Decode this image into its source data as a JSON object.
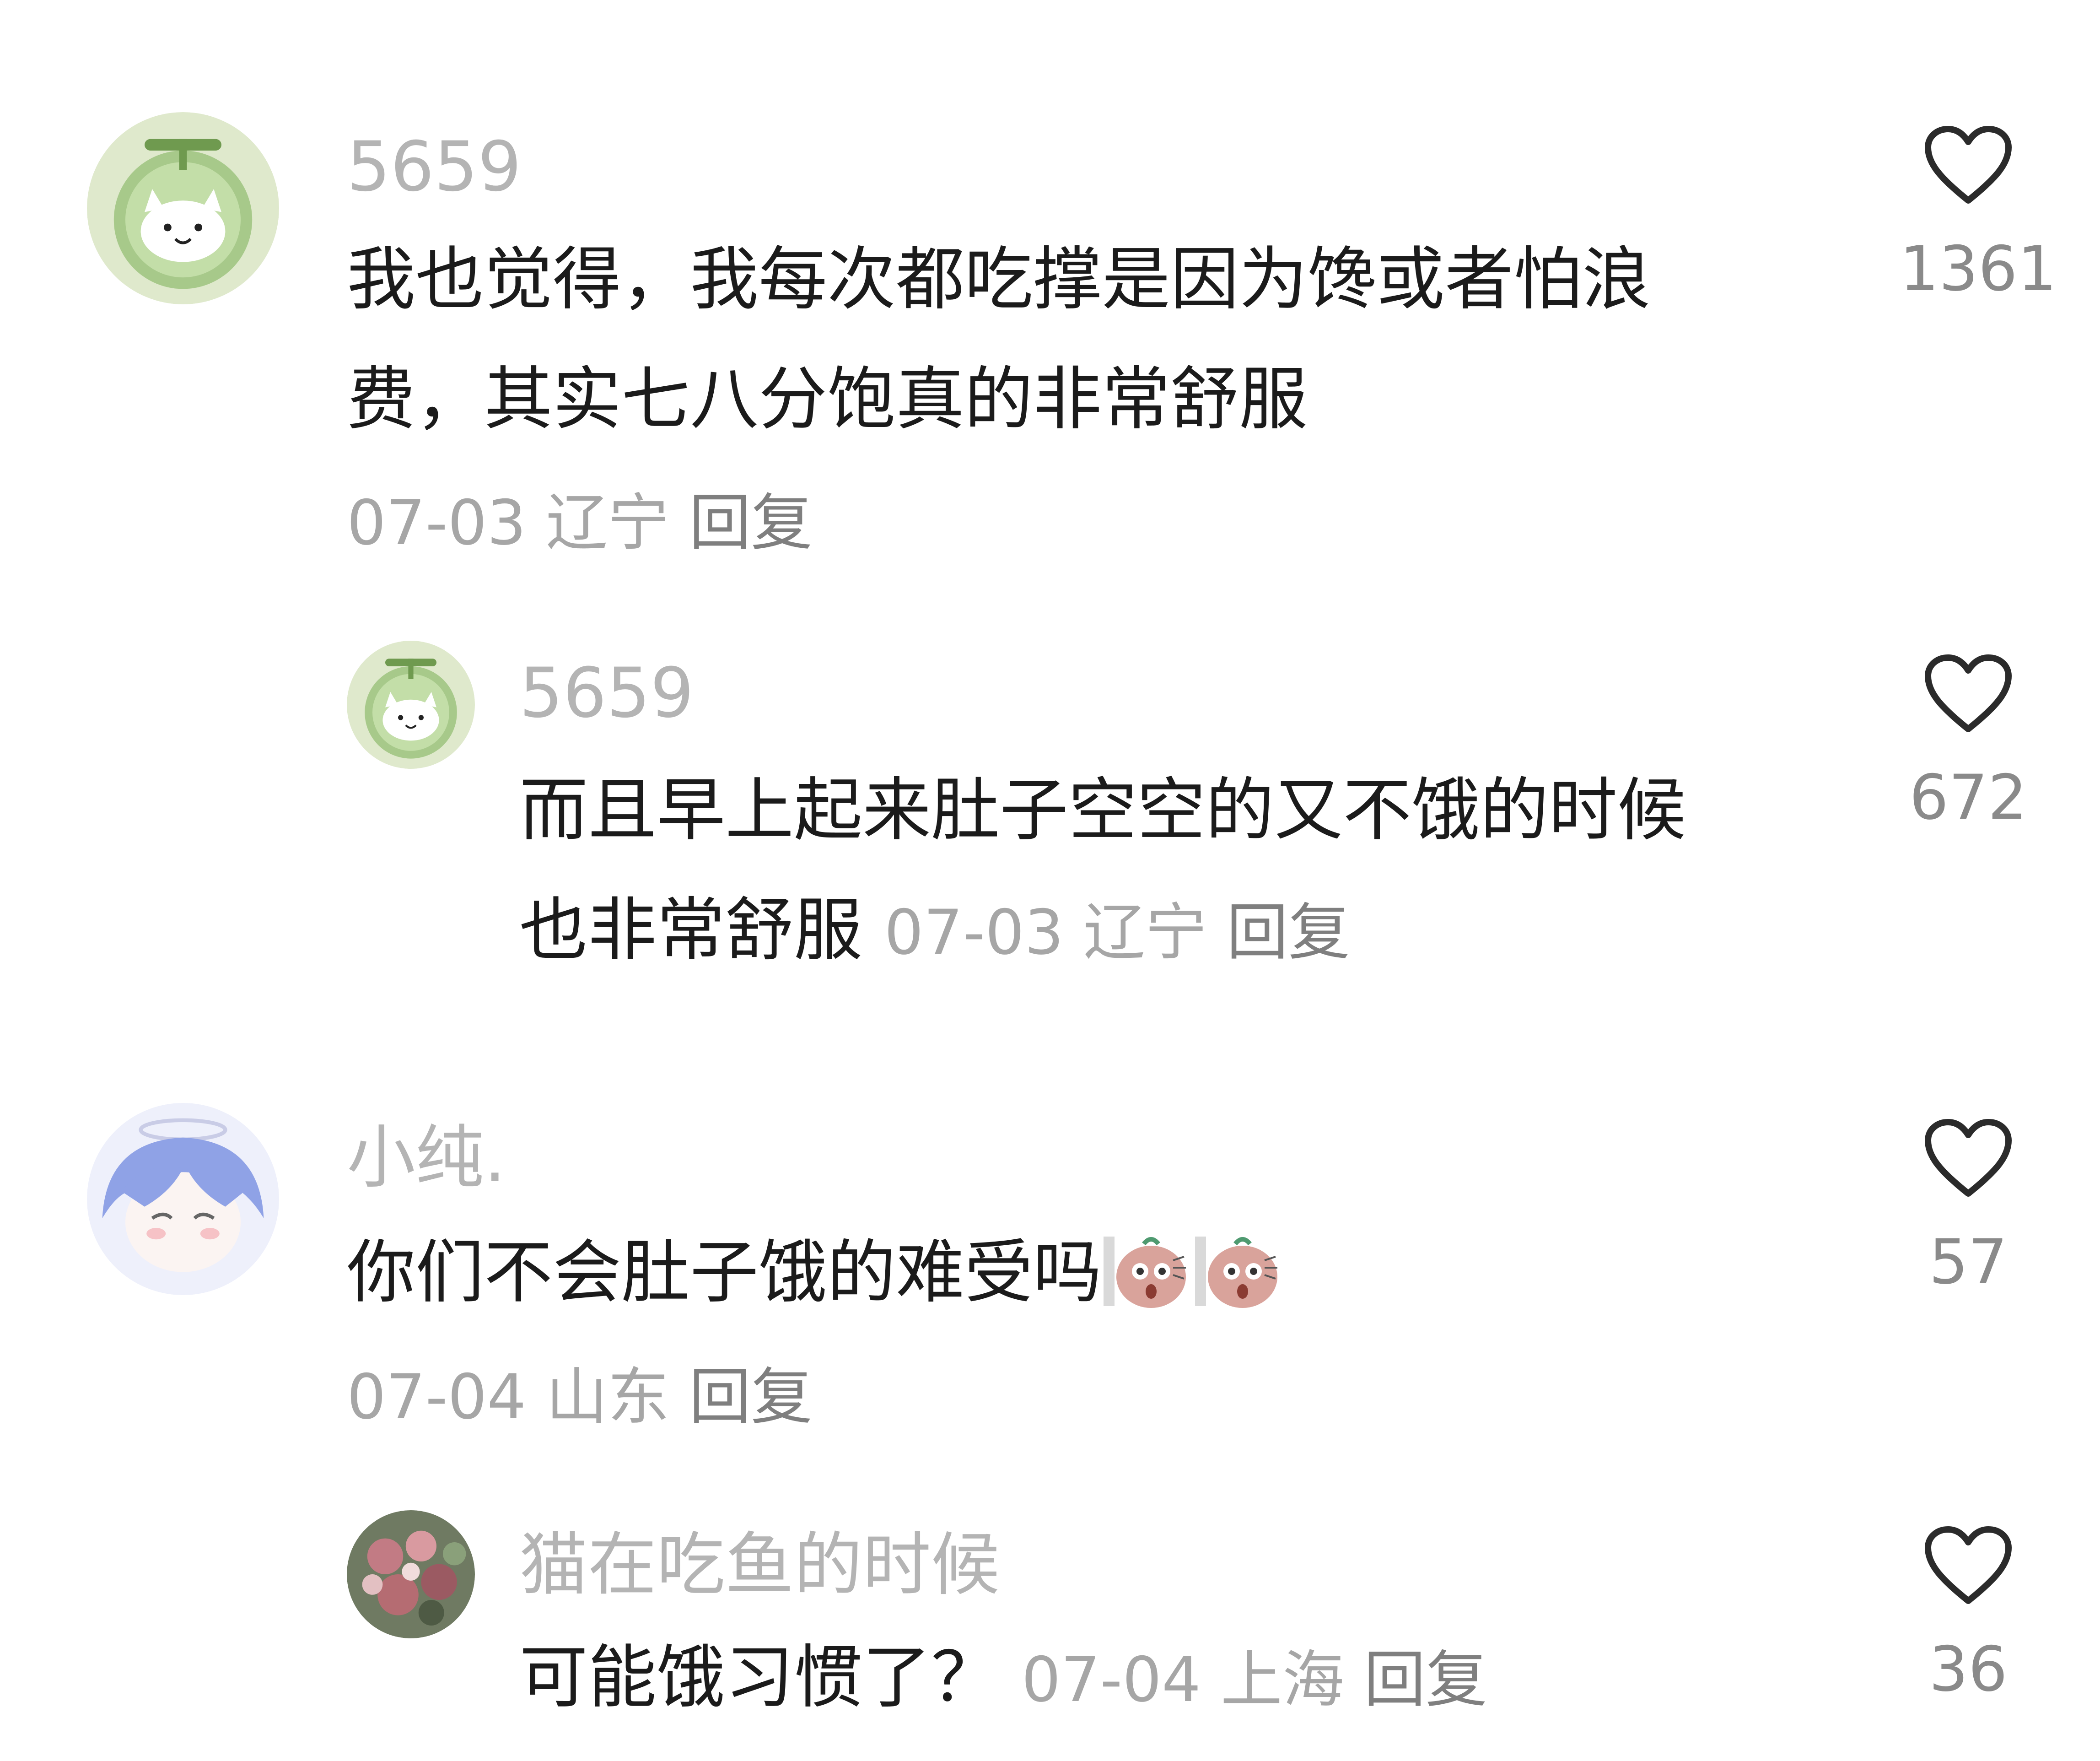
{
  "comments": [
    {
      "username": "5659",
      "text_line1": "我也觉得，我每次都吃撑是因为馋或者怕浪",
      "text_line2": "费，其实七八分饱真的非常舒服",
      "date": "07-03",
      "location": "辽宁",
      "reply_label": "回复",
      "likes": "1361",
      "avatar_icon": "melon-cat-avatar"
    },
    {
      "username": "5659",
      "text_line1": "而且早上起来肚子空空的又不饿的时候",
      "text_line2": "也非常舒服",
      "date": "07-03",
      "location": "辽宁",
      "reply_label": "回复",
      "likes": "672",
      "avatar_icon": "melon-cat-avatar",
      "is_reply": true
    },
    {
      "username": "小纯.",
      "text_line1": "你们不会肚子饿的难受吗",
      "stickers": [
        "shocked-sticker",
        "shocked-sticker"
      ],
      "date": "07-04",
      "location": "山东",
      "reply_label": "回复",
      "likes": "57",
      "avatar_icon": "anime-girl-avatar"
    },
    {
      "username": "猫在吃鱼的时候",
      "text_line1": "可能饿习惯了？",
      "date": "07-04",
      "location": "上海",
      "reply_label": "回复",
      "likes": "36",
      "avatar_icon": "photo-avatar",
      "is_reply": true
    }
  ],
  "colors": {
    "username": "#b4b4b4",
    "text": "#1b1b1b",
    "meta": "#a6a6a6",
    "like_icon": "#2b2b2b",
    "like_count": "#8a8a8a"
  }
}
